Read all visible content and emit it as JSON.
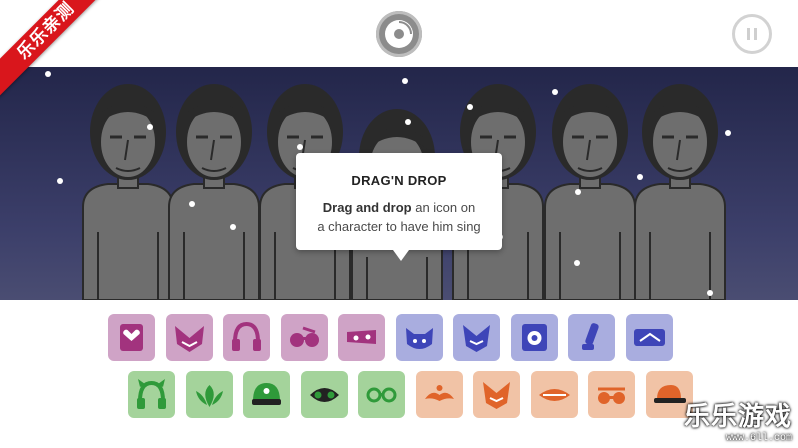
{
  "ribbon": {
    "text": "乐乐亲测"
  },
  "top_controls": {
    "center_icon": "vinyl-record-icon",
    "right_icon": "pause-icon"
  },
  "tooltip": {
    "title": "DRAG'N DROP",
    "body_bold": "Drag and drop",
    "body_line1_rest": " an icon on",
    "body_line2": "a character to have him sing"
  },
  "watermark": {
    "text": "乐乐游戏",
    "url": "www.6ll.com"
  },
  "colors": {
    "stage_top": "#23264a",
    "stage_bottom": "#4a4d72",
    "character": "#6e6e6e",
    "pink_bg": "#cfa3c6",
    "pink_fg": "#a2337e",
    "blue_bg": "#a9addf",
    "blue_fg": "#3e45b8",
    "green_bg": "#a4d39b",
    "green_fg": "#2f9a3a",
    "orange_bg": "#f1c3a6",
    "orange_fg": "#e0642a"
  },
  "icon_rows": [
    [
      {
        "name": "pink-square-heart-icon",
        "theme": "pink"
      },
      {
        "name": "pink-fox-mask-icon",
        "theme": "pink"
      },
      {
        "name": "pink-headphones-icon",
        "theme": "pink"
      },
      {
        "name": "pink-sunglasses-icon",
        "theme": "pink"
      },
      {
        "name": "pink-blindfold-icon",
        "theme": "pink"
      },
      {
        "name": "blue-cat-ears-icon",
        "theme": "blue"
      },
      {
        "name": "blue-fox-mask-icon",
        "theme": "blue"
      },
      {
        "name": "blue-speaker-box-icon",
        "theme": "blue"
      },
      {
        "name": "blue-microphone-icon",
        "theme": "blue"
      },
      {
        "name": "blue-visor-icon",
        "theme": "blue"
      }
    ],
    [
      {
        "name": "green-horned-headphones-icon",
        "theme": "green"
      },
      {
        "name": "green-leaf-icon",
        "theme": "green"
      },
      {
        "name": "green-helmet-icon",
        "theme": "green"
      },
      {
        "name": "green-mask-icon",
        "theme": "green"
      },
      {
        "name": "green-goggles-icon",
        "theme": "green"
      },
      {
        "name": "orange-mustache-icon",
        "theme": "orange"
      },
      {
        "name": "orange-fox-mask-icon",
        "theme": "orange"
      },
      {
        "name": "orange-lips-icon",
        "theme": "orange"
      },
      {
        "name": "orange-glasses-icon",
        "theme": "orange"
      },
      {
        "name": "orange-cap-icon",
        "theme": "orange"
      }
    ]
  ]
}
